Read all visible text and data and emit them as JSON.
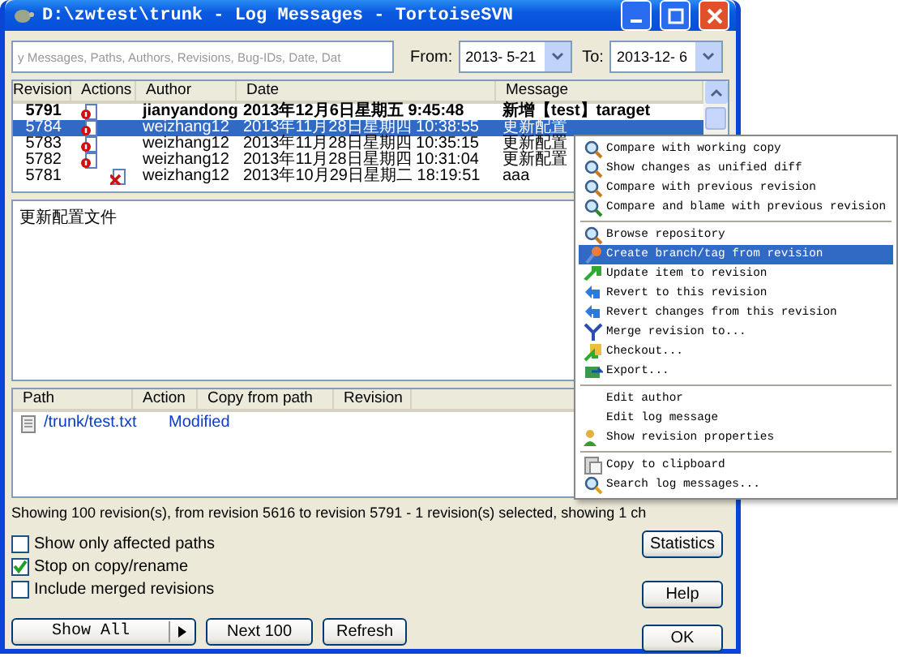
{
  "window": {
    "title": "D:\\zwtest\\trunk - Log Messages - TortoiseSVN"
  },
  "filter": {
    "placeholder": "y Messages, Paths, Authors, Revisions, Bug-IDs, Date, Dat",
    "from_label": "From:",
    "from": "2013- 5-21",
    "to_label": "To:",
    "to": "2013-12- 6"
  },
  "log": {
    "columns": [
      "Revision",
      "Actions",
      "Author",
      "Date",
      "Message"
    ],
    "rows": [
      {
        "revision": "5791",
        "kind": "modified",
        "author": "jianyandong",
        "date": "2013年12月6日星期五 9:45:48",
        "message": "新增【test】taraget",
        "current": true,
        "selected": false
      },
      {
        "revision": "5784",
        "kind": "modified",
        "author": "weizhang12",
        "date": "2013年11月28日星期四 10:38:55",
        "message": "更新配置",
        "current": false,
        "selected": true
      },
      {
        "revision": "5783",
        "kind": "modified",
        "author": "weizhang12",
        "date": "2013年11月28日星期四 10:35:15",
        "message": "更新配置",
        "current": false,
        "selected": false
      },
      {
        "revision": "5782",
        "kind": "modified",
        "author": "weizhang12",
        "date": "2013年11月28日星期四 10:31:04",
        "message": "更新配置",
        "current": false,
        "selected": false
      },
      {
        "revision": "5781",
        "kind": "deleted",
        "author": "weizhang12",
        "date": "2013年10月29日星期二 18:19:51",
        "message": "aaa",
        "current": false,
        "selected": false
      }
    ]
  },
  "message_pane": {
    "text": "更新配置文件"
  },
  "paths": {
    "columns": [
      "Path",
      "Action",
      "Copy from path",
      "Revision"
    ],
    "rows": [
      {
        "path": "/trunk/test.txt",
        "action": "Modified"
      }
    ]
  },
  "status": "Showing 100 revision(s), from revision 5616 to revision 5791 - 1 revision(s) selected, showing 1 ch",
  "options": [
    {
      "label": "Show only affected paths",
      "checked": false
    },
    {
      "label": "Stop on copy/rename",
      "checked": true
    },
    {
      "label": "Include merged revisions",
      "checked": false
    }
  ],
  "buttons": {
    "show_all": "Show All",
    "next": "Next 100",
    "refresh": "Refresh",
    "statistics": "Statistics",
    "help": "Help",
    "ok": "OK"
  },
  "context_menu": {
    "items": [
      {
        "kind": "item",
        "label": "Compare with working copy",
        "selected": false
      },
      {
        "kind": "item",
        "label": "Show changes as unified diff",
        "selected": false
      },
      {
        "kind": "item",
        "label": "Compare with previous revision",
        "selected": false
      },
      {
        "kind": "item",
        "label": "Compare and blame with previous revision",
        "selected": false
      },
      {
        "kind": "separator"
      },
      {
        "kind": "item",
        "label": "Browse repository",
        "selected": false
      },
      {
        "kind": "item",
        "label": "Create branch/tag from revision",
        "selected": true
      },
      {
        "kind": "item",
        "label": "Update item to revision",
        "selected": false
      },
      {
        "kind": "item",
        "label": "Revert to this revision",
        "selected": false
      },
      {
        "kind": "item",
        "label": "Revert changes from this revision",
        "selected": false
      },
      {
        "kind": "item",
        "label": "Merge revision to...",
        "selected": false
      },
      {
        "kind": "item",
        "label": "Checkout...",
        "selected": false
      },
      {
        "kind": "item",
        "label": "Export...",
        "selected": false
      },
      {
        "kind": "separator"
      },
      {
        "kind": "item",
        "label": "Edit author",
        "selected": false
      },
      {
        "kind": "item",
        "label": "Edit log message",
        "selected": false
      },
      {
        "kind": "item",
        "label": "Show revision properties",
        "selected": false
      },
      {
        "kind": "separator"
      },
      {
        "kind": "item",
        "label": "Copy to clipboard",
        "selected": false
      },
      {
        "kind": "item",
        "label": "Search log messages...",
        "selected": false
      }
    ]
  }
}
